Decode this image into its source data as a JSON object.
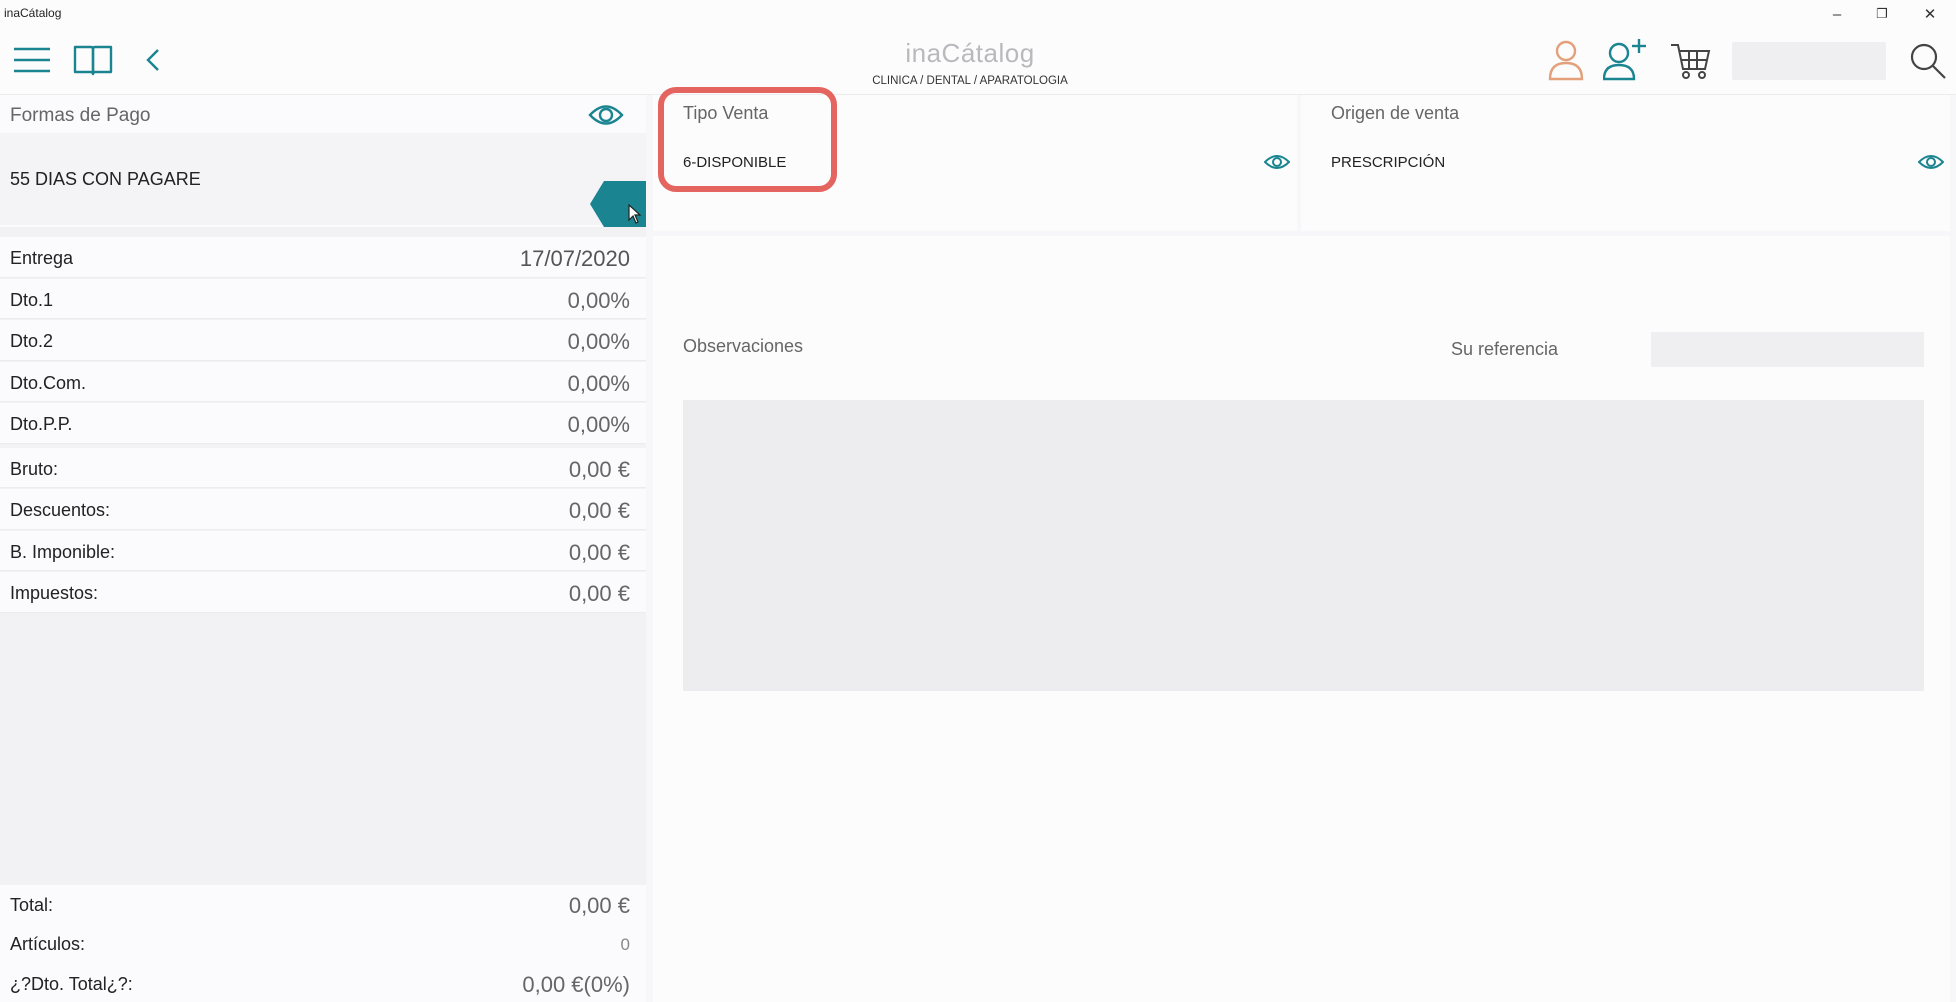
{
  "window": {
    "title": "inaCátalog",
    "minimize": "–",
    "restore": "❐",
    "close": "✕"
  },
  "header": {
    "brand": "inaCátalog",
    "subtitle": "CLINICA / DENTAL / APARATOLOGIA",
    "search_value": ""
  },
  "colors": {
    "accent": "#1a8590",
    "customer_icon": "#e3a07a",
    "highlight": "#e4655f"
  },
  "icons": [
    "menu-icon",
    "book-icon",
    "back-icon",
    "customer-icon",
    "add-customer-icon",
    "cart-icon",
    "search-icon",
    "eye-icon"
  ],
  "payment": {
    "label": "Formas de Pago",
    "value": "55 DIAS CON PAGARE"
  },
  "tipo_venta": {
    "label": "Tipo Venta",
    "value": "6-DISPONIBLE"
  },
  "origen_venta": {
    "label": "Origen de venta",
    "value": "PRESCRIPCIÓN"
  },
  "details": [
    {
      "label": "Entrega",
      "value": "17/07/2020"
    },
    {
      "label": "Dto.1",
      "value": "0,00%"
    },
    {
      "label": "Dto.2",
      "value": "0,00%"
    },
    {
      "label": "Dto.Com.",
      "value": "0,00%"
    },
    {
      "label": "Dto.P.P.",
      "value": "0,00%"
    },
    {
      "label": "Bruto:",
      "value": "0,00 €"
    },
    {
      "label": "Descuentos:",
      "value": "0,00 €"
    },
    {
      "label": "B. Imponible:",
      "value": "0,00 €"
    },
    {
      "label": "Impuestos:",
      "value": "0,00 €"
    }
  ],
  "summary": [
    {
      "label": "Total:",
      "value": "0,00 €"
    },
    {
      "label": "Artículos:",
      "value": "0"
    },
    {
      "label": "¿?Dto. Total¿?:",
      "value": "0,00 €(0%)"
    }
  ],
  "observations": {
    "label": "Observaciones",
    "value": ""
  },
  "reference": {
    "label": "Su referencia",
    "value": ""
  }
}
